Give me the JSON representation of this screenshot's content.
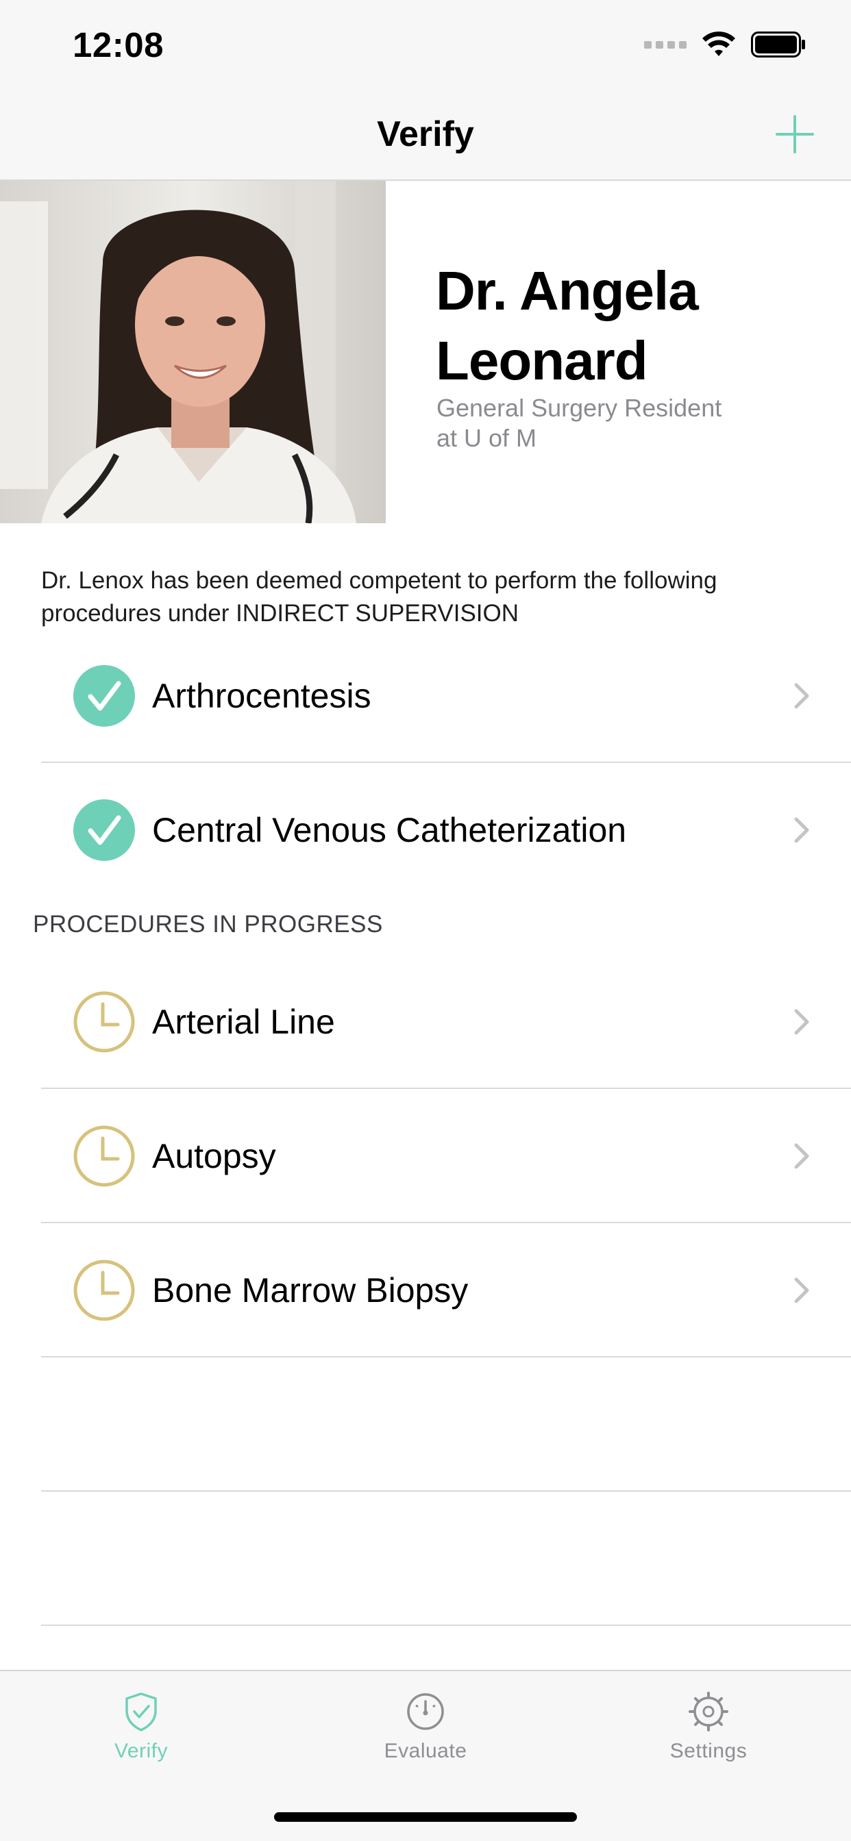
{
  "status_bar": {
    "time": "12:08"
  },
  "nav": {
    "title": "Verify",
    "add_icon": "plus-icon"
  },
  "profile": {
    "name_line1": "Dr. Angela",
    "name_line2": "Leonard",
    "role_line1": "General Surgery Resident",
    "role_line2": "at U of M"
  },
  "intro_text": "Dr. Lenox has been deemed competent to perform the following procedures under INDIRECT SUPERVISION",
  "competent": [
    {
      "label": "Arthrocentesis",
      "status": "verified"
    },
    {
      "label": "Central Venous Catheterization",
      "status": "verified"
    }
  ],
  "in_progress_header": "PROCEDURES IN PROGRESS",
  "in_progress": [
    {
      "label": "Arterial Line",
      "status": "pending"
    },
    {
      "label": "Autopsy",
      "status": "pending"
    },
    {
      "label": "Bone Marrow Biopsy",
      "status": "pending"
    }
  ],
  "tabs": [
    {
      "label": "Verify",
      "icon": "shield-check-icon",
      "active": true
    },
    {
      "label": "Evaluate",
      "icon": "gauge-icon",
      "active": false
    },
    {
      "label": "Settings",
      "icon": "gear-icon",
      "active": false
    }
  ],
  "colors": {
    "accent": "#6fd0b8",
    "pending": "#d6c27c",
    "inactive": "#8e8e93"
  }
}
